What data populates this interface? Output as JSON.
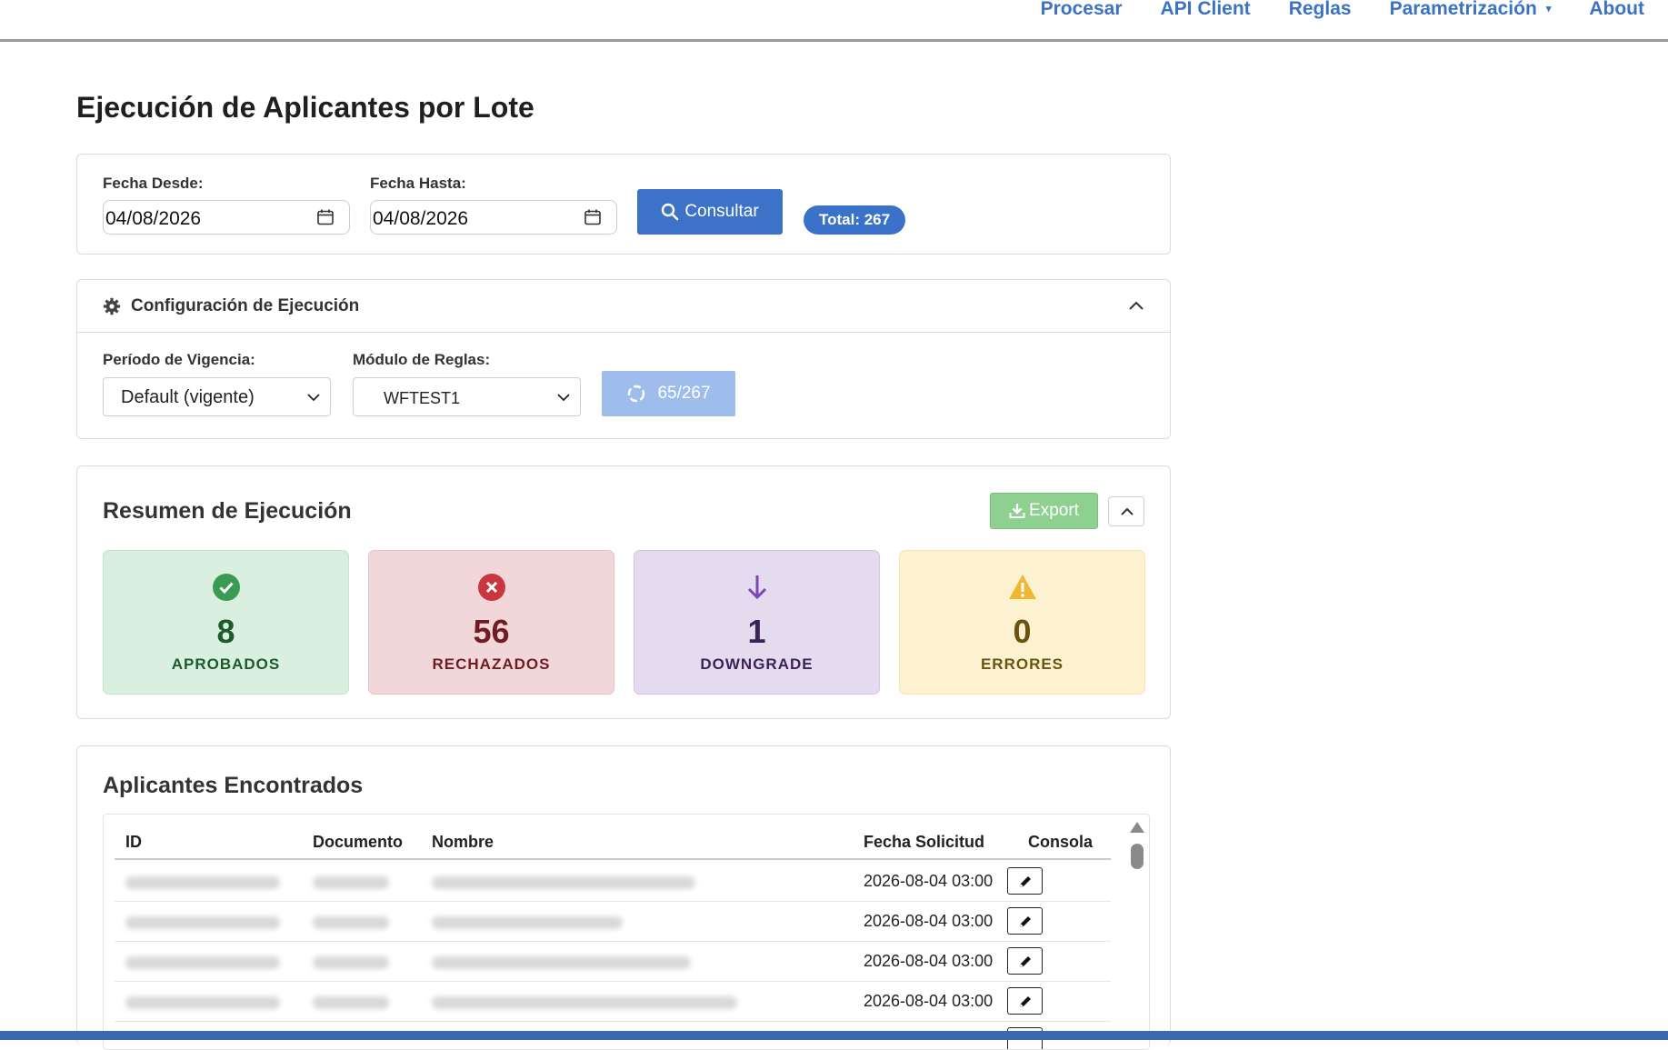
{
  "nav": {
    "items": [
      {
        "label": "Procesar"
      },
      {
        "label": "API Client"
      },
      {
        "label": "Reglas"
      },
      {
        "label": "Parametrización",
        "caret": "▾"
      },
      {
        "label": "About"
      }
    ]
  },
  "page_title": "Ejecución de Aplicantes por Lote",
  "filters": {
    "from_label": "Fecha Desde:",
    "from_value": "04/08/2026",
    "to_label": "Fecha Hasta:",
    "to_value": "04/08/2026",
    "consultar_label": "Consultar",
    "total_badge": "Total: 267"
  },
  "config": {
    "title": "Configuración de Ejecución",
    "periodo_label": "Período de Vigencia:",
    "periodo_value": "Default (vigente)",
    "modulo_label": "Módulo de Reglas:",
    "modulo_value": "WFTEST1",
    "progress_label": "65/267",
    "progress_fraction": 0.243
  },
  "summary": {
    "title": "Resumen de Ejecución",
    "export_label": "Export",
    "stats": [
      {
        "value": "8",
        "label": "APROBADOS",
        "icon": "check-circle-icon",
        "bg": "#d9efdf",
        "border": "#c4e4cc",
        "color": "#1e5a2c",
        "icon_color": "#3b9b52"
      },
      {
        "value": "56",
        "label": "RECHAZADOS",
        "icon": "x-circle-icon",
        "bg": "#f2d7da",
        "border": "#e8c1c5",
        "color": "#6e1d24",
        "icon_color": "#c9363f"
      },
      {
        "value": "1",
        "label": "DOWNGRADE",
        "icon": "arrow-down-icon",
        "bg": "#e5dbef",
        "border": "#d3c3e6",
        "color": "#3b2356",
        "icon_color": "#7b48b5"
      },
      {
        "value": "0",
        "label": "ERRORES",
        "icon": "warning-icon",
        "bg": "#fcf2cf",
        "border": "#f5e6b0",
        "color": "#6a5410",
        "icon_color": "#f0b732"
      }
    ]
  },
  "applicants": {
    "title": "Aplicantes Encontrados",
    "columns": [
      "ID",
      "Documento",
      "Nombre",
      "Fecha Solicitud",
      "Consola"
    ],
    "rows": [
      {
        "fecha": "2026-08-04 03:00"
      },
      {
        "fecha": "2026-08-04 03:00"
      },
      {
        "fecha": "2026-08-04 03:00"
      },
      {
        "fecha": "2026-08-04 03:00"
      }
    ]
  }
}
